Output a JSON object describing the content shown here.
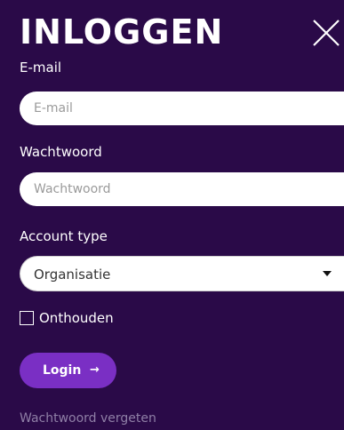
{
  "login": {
    "title": "INLOGGEN",
    "close_icon": "close-icon",
    "email": {
      "label": "E-mail",
      "placeholder": "E-mail",
      "value": ""
    },
    "password": {
      "label": "Wachtwoord",
      "placeholder": "Wachtwoord",
      "value": ""
    },
    "account_type": {
      "label": "Account type",
      "selected": "Organisatie",
      "caret_icon": "caret-down-icon"
    },
    "remember": {
      "label": "Onthouden",
      "checked": false
    },
    "submit": {
      "label": "Login",
      "arrow": "→",
      "arrow_icon": "arrow-right-icon"
    },
    "forgot_label": "Wachtwoord vergeten"
  },
  "colors": {
    "background": "#2a0a48",
    "button": "#7a2fc4",
    "text": "#ffffff",
    "link": "#8f7fa6"
  }
}
